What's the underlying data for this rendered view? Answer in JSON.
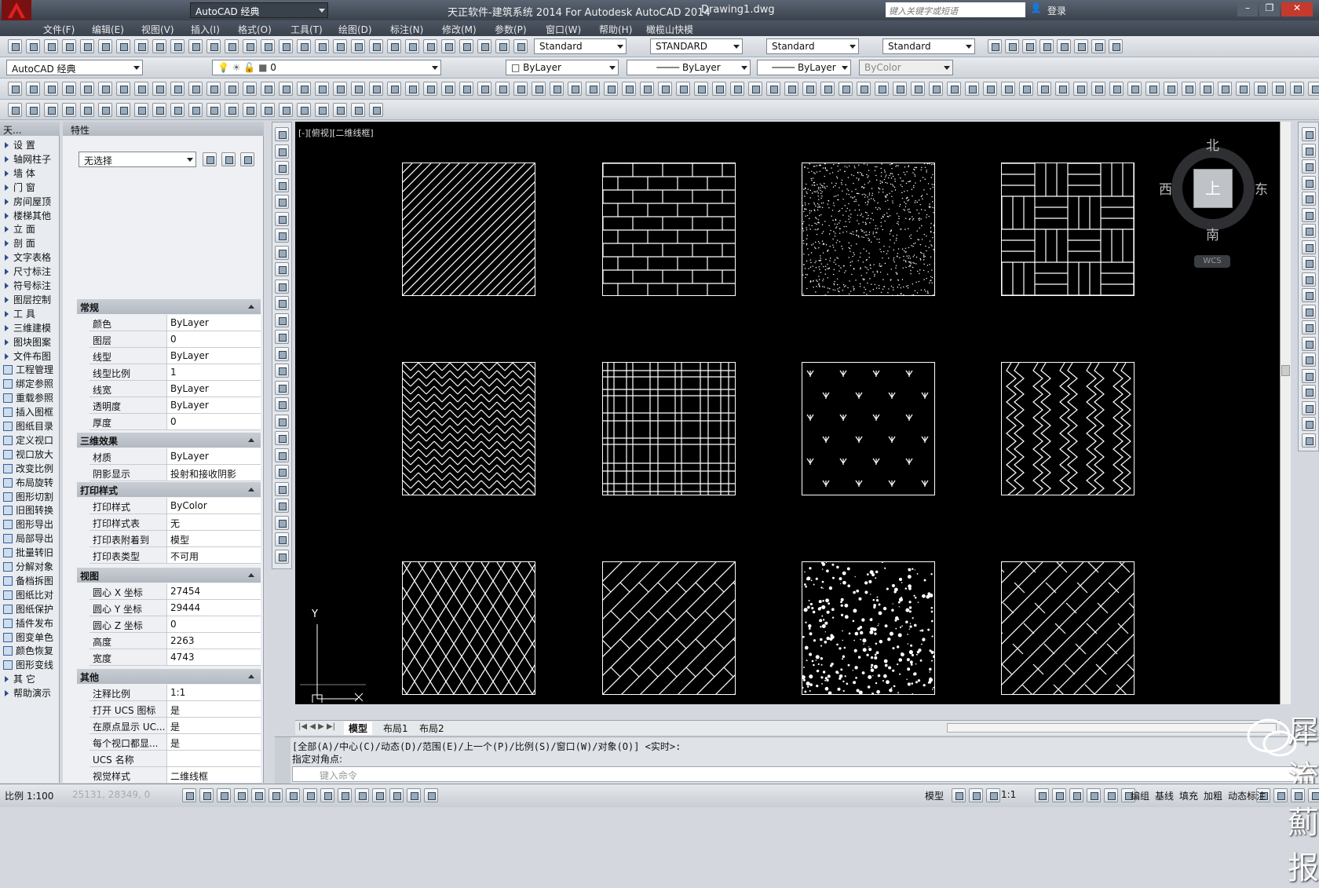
{
  "title": {
    "app_title": "天正软件-建筑系统 2014  For Autodesk AutoCAD 2014",
    "doc_title": "Drawing1.dwg",
    "qat_workspace": "AutoCAD 经典",
    "search_placeholder": "键入关键字或短语",
    "login": "登录"
  },
  "menu": [
    "文件(F)",
    "编辑(E)",
    "视图(V)",
    "插入(I)",
    "格式(O)",
    "工具(T)",
    "绘图(D)",
    "标注(N)",
    "修改(M)",
    "参数(P)",
    "窗口(W)",
    "帮助(H)",
    "橄榄山快模"
  ],
  "toolbar_styles": {
    "text_style": "Standard",
    "dim_style": "STANDARD",
    "table_style": "Standard",
    "mleader_style": "Standard"
  },
  "layers_bar": {
    "workspace": "AutoCAD 经典",
    "layer": "0",
    "color": "ByLayer",
    "linetype": "ByLayer",
    "lineweight": "ByLayer",
    "plotstyle": "ByColor"
  },
  "tianzheng_menu": [
    "设  置",
    "轴网柱子",
    "墙  体",
    "门  窗",
    "房间屋顶",
    "楼梯其他",
    "立  面",
    "剖  面",
    "文字表格",
    "尺寸标注",
    "符号标注",
    "图层控制",
    "工  具",
    "三维建模",
    "图块图案",
    "文件布图",
    "工程管理",
    "绑定参照",
    "重载参照",
    "插入图框",
    "图纸目录",
    "定义视口",
    "视口放大",
    "改变比例",
    "布局旋转",
    "图形切割",
    "旧图转换",
    "图形导出",
    "局部导出",
    "批量转旧",
    "分解对象",
    "备档拆图",
    "图纸比对",
    "图纸保护",
    "插件发布",
    "图变单色",
    "颜色恢复",
    "图形变线",
    "其  它",
    "帮助演示"
  ],
  "tianzheng_title": "天...",
  "properties": {
    "title": "特性",
    "selection": "无选择",
    "sections": [
      {
        "name": "常规",
        "rows": [
          [
            "颜色",
            "ByLayer"
          ],
          [
            "图层",
            "0"
          ],
          [
            "线型",
            "ByLayer"
          ],
          [
            "线型比例",
            "1"
          ],
          [
            "线宽",
            "ByLayer"
          ],
          [
            "透明度",
            "ByLayer"
          ],
          [
            "厚度",
            "0"
          ]
        ]
      },
      {
        "name": "三维效果",
        "rows": [
          [
            "材质",
            "ByLayer"
          ],
          [
            "阴影显示",
            "投射和接收阴影"
          ]
        ]
      },
      {
        "name": "打印样式",
        "rows": [
          [
            "打印样式",
            "ByColor"
          ],
          [
            "打印样式表",
            "无"
          ],
          [
            "打印表附着到",
            "模型"
          ],
          [
            "打印表类型",
            "不可用"
          ]
        ]
      },
      {
        "name": "视图",
        "rows": [
          [
            "圆心 X 坐标",
            "27454"
          ],
          [
            "圆心 Y 坐标",
            "29444"
          ],
          [
            "圆心 Z 坐标",
            "0"
          ],
          [
            "高度",
            "2263"
          ],
          [
            "宽度",
            "4743"
          ]
        ]
      },
      {
        "name": "其他",
        "rows": [
          [
            "注释比例",
            "1:1"
          ],
          [
            "打开 UCS 图标",
            "是"
          ],
          [
            "在原点显示 UC...",
            "是"
          ],
          [
            "每个视口都显...",
            "是"
          ],
          [
            "UCS 名称",
            ""
          ],
          [
            "视觉样式",
            "二维线框"
          ]
        ]
      }
    ]
  },
  "viewport": {
    "label": "[-][俯视][二维线框]",
    "compass": {
      "north": "北",
      "south": "南",
      "east": "东",
      "west": "西",
      "top": "上",
      "wcs": "WCS"
    },
    "y_axis": "Y"
  },
  "layout_tabs": [
    "模型",
    "布局1",
    "布局2"
  ],
  "command": {
    "line1": "[全部(A)/中心(C)/动态(D)/范围(E)/上一个(P)/比例(S)/窗口(W)/对象(O)] <实时>:",
    "line2": "指定对角点:",
    "prompt": "键入命令"
  },
  "watermark": "犀流薊报",
  "status": {
    "scale": "比例 1:100",
    "coords": "25131, 28349, 0",
    "model": "模型",
    "anno": "1:1",
    "right_items": [
      "编组",
      "基线",
      "填充",
      "加粗",
      "动态标注"
    ]
  }
}
